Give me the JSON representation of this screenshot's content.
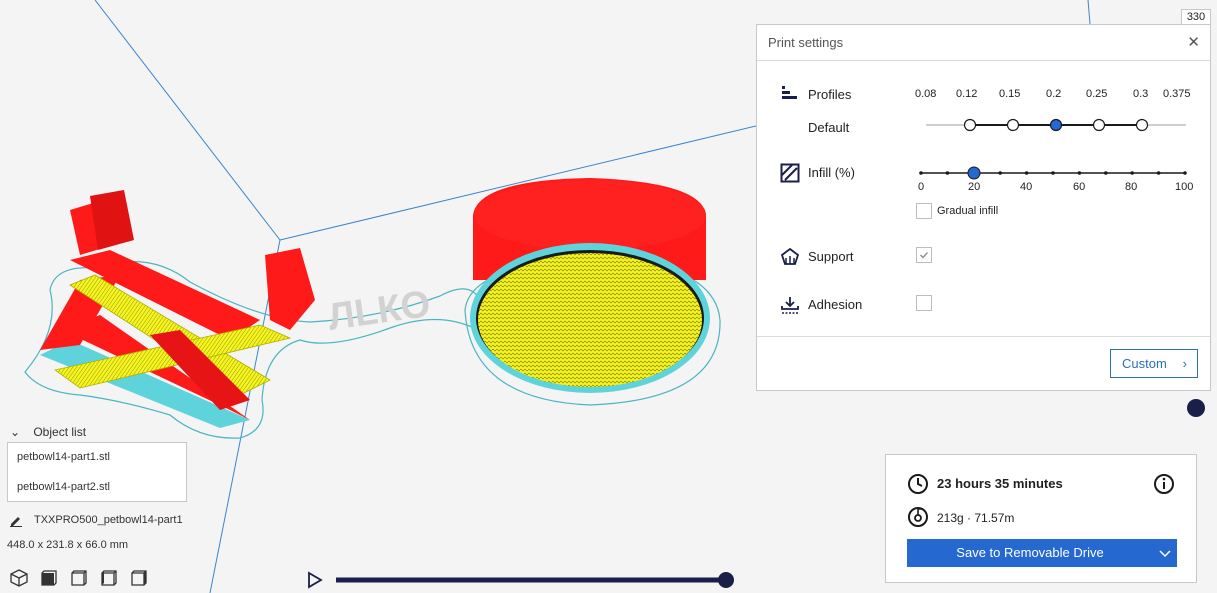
{
  "print_settings": {
    "title": "Print settings",
    "profiles": {
      "label": "Profiles",
      "sublabel": "Default",
      "values": [
        "0.08",
        "0.12",
        "0.15",
        "0.2",
        "0.25",
        "0.3",
        "0.375"
      ],
      "selected": "0.2"
    },
    "infill": {
      "label": "Infill (%)",
      "ticks": [
        "0",
        "20",
        "40",
        "60",
        "80",
        "100"
      ],
      "value": 20,
      "gradual_label": "Gradual infill",
      "gradual_checked": false
    },
    "support": {
      "label": "Support",
      "checked": true
    },
    "adhesion": {
      "label": "Adhesion",
      "checked": false
    },
    "custom_label": "Custom"
  },
  "layer_view": {
    "max_layer": "330"
  },
  "print_estimate": {
    "time": "23 hours 35 minutes",
    "material": "213g · 71.57m",
    "save_label": "Save to Removable Drive"
  },
  "object_list": {
    "header": "Object list",
    "items": [
      "petbowl14-part1.stl",
      "petbowl14-part2.stl"
    ],
    "selected_name": "TXXPRO500_petbowl14-part1",
    "dimensions": "448.0 x 231.8 x 66.0 mm"
  },
  "view_buttons": [
    "3d-view",
    "front-view",
    "top-view",
    "left-view",
    "right-view"
  ],
  "colors": {
    "accent": "#2468d0",
    "wall": "#ff1a1a",
    "infill": "#f2f21a",
    "skirt": "#5fd3dc",
    "slider": "#1a1f4a"
  }
}
